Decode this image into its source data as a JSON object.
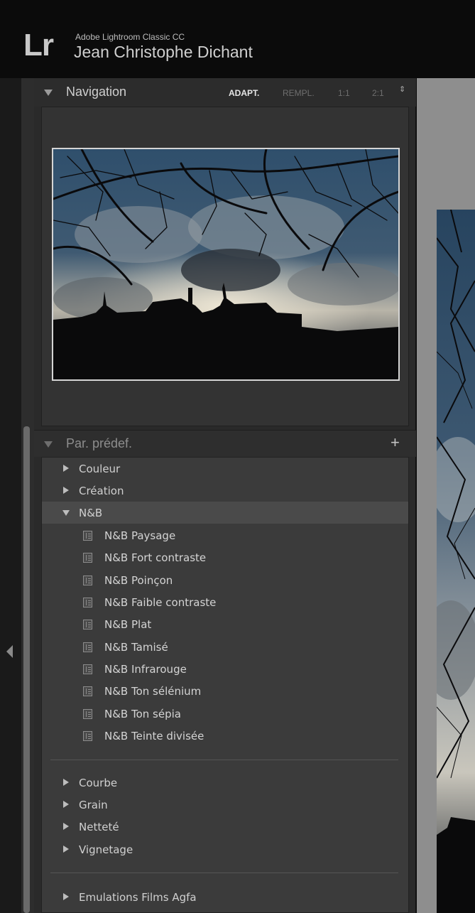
{
  "header": {
    "logo": "Lr",
    "app_title": "Adobe Lightroom Classic CC",
    "user_name": "Jean Christophe Dichant"
  },
  "navigation": {
    "title": "Navigation",
    "zoom_options": [
      "ADAPT.",
      "REMPL.",
      "1:1",
      "2:1"
    ],
    "selected_zoom": "ADAPT.",
    "stepper": "⇕"
  },
  "presets": {
    "title": "Par. prédef.",
    "add_label": "+",
    "groups_top": [
      "Couleur",
      "Création"
    ],
    "open_group": "N&B",
    "items": [
      "N&B Paysage",
      "N&B Fort contraste",
      "N&B Poinçon",
      "N&B Faible contraste",
      "N&B Plat",
      "N&B Tamisé",
      "N&B Infrarouge",
      "N&B Ton sélénium",
      "N&B Ton sépia",
      "N&B Teinte divisée"
    ],
    "groups_mid": [
      "Courbe",
      "Grain",
      "Netteté",
      "Vignetage"
    ],
    "groups_bottom": [
      "Emulations Films Agfa"
    ]
  },
  "colors": {
    "background": "#0b0b0b",
    "panel": "#2a2a2a",
    "panel_body": "#3b3b3b",
    "selected_row": "#4a4a4a",
    "main_area": "#8e8e8e"
  }
}
